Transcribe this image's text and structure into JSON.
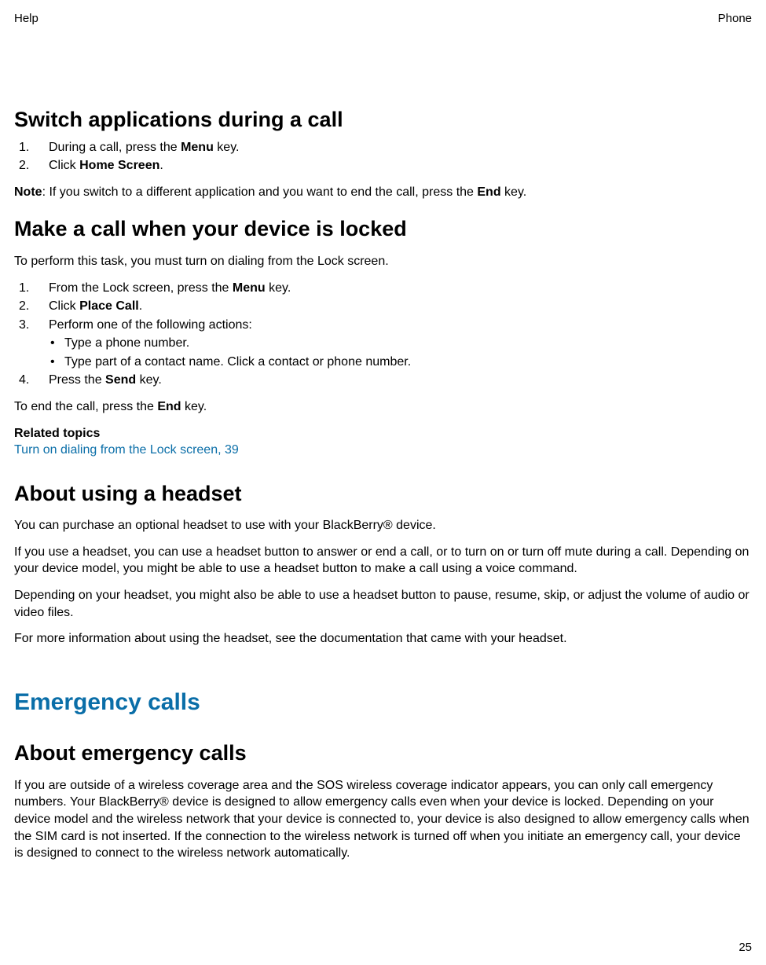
{
  "header": {
    "left": "Help",
    "right": "Phone"
  },
  "section1": {
    "title": "Switch applications during a call",
    "steps": [
      {
        "before": "During a call, press the ",
        "bold": "Menu",
        "after": " key."
      },
      {
        "before": "Click ",
        "bold": "Home Screen",
        "after": "."
      }
    ],
    "note": {
      "label": "Note",
      "before": ":  If you switch to a different application and you want to end the call, press the ",
      "bold": "End",
      "after": " key."
    }
  },
  "section2": {
    "title": "Make a call when your device is locked",
    "intro": "To perform this task, you must turn on dialing from the Lock screen.",
    "steps": [
      {
        "before": "From the Lock screen, press the ",
        "bold": "Menu",
        "after": " key."
      },
      {
        "before": "Click ",
        "bold": "Place Call",
        "after": "."
      },
      {
        "before": "Perform one of the following actions:",
        "bold": "",
        "after": ""
      },
      {
        "before": "Press the ",
        "bold": "Send",
        "after": " key."
      }
    ],
    "substeps": [
      "Type a phone number.",
      "Type part of a contact name. Click a contact or phone number."
    ],
    "outro": {
      "before": "To end the call, press the ",
      "bold": "End",
      "after": " key."
    },
    "related_label": "Related topics",
    "related_link": "Turn on dialing from the Lock screen, 39"
  },
  "section3": {
    "title": "About using a headset",
    "paras": [
      "You can purchase an optional headset to use with your BlackBerry® device.",
      "If you use a headset, you can use a headset button to answer or end a call, or to turn on or turn off mute during a call. Depending on your device model, you might be able to use a headset button to make a call using a voice command.",
      "Depending on your headset, you might also be able to use a headset button to pause, resume, skip, or adjust the volume of audio or video files.",
      "For more information about using the headset, see the documentation that came with your headset."
    ]
  },
  "chapter": {
    "title": "Emergency calls"
  },
  "section4": {
    "title": "About emergency calls",
    "para": "If you are outside of a wireless coverage area and the SOS wireless coverage indicator appears, you can only call emergency numbers. Your BlackBerry® device is designed to allow emergency calls even when your device is locked. Depending on your device model and the wireless network that your device is connected to, your device is also designed to allow emergency calls when the SIM card is not inserted. If the connection to the wireless network is turned off when you initiate an emergency call, your device is designed to connect to the wireless network automatically."
  },
  "page_number": "25"
}
